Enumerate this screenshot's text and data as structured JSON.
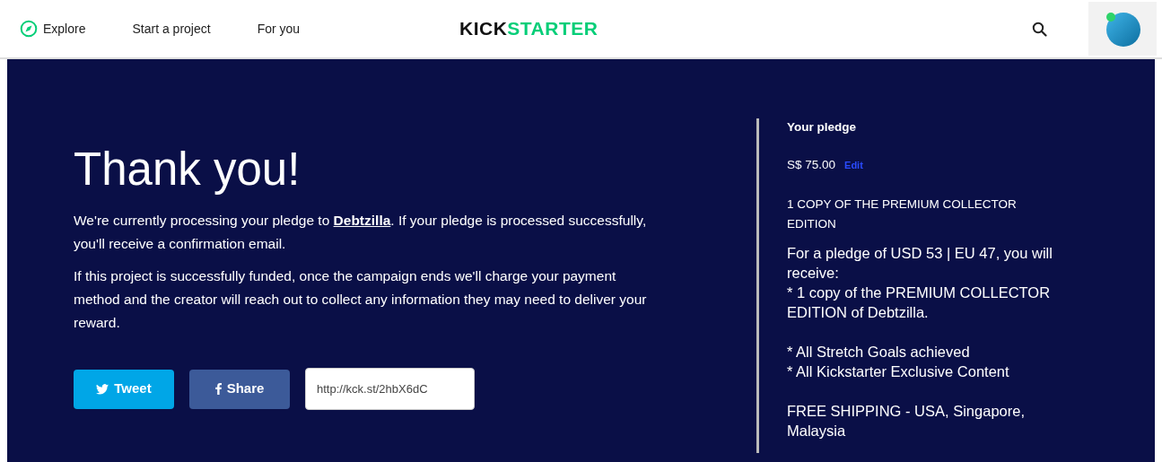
{
  "nav": {
    "items": [
      {
        "label": "Explore",
        "kind": "explore"
      },
      {
        "label": "Start a project",
        "kind": "plain"
      },
      {
        "label": "For you",
        "kind": "plain"
      }
    ],
    "logo": {
      "part_1": "KICK",
      "part_2": "STARTER"
    }
  },
  "thanks": {
    "title": "Thank you!",
    "paragraph_1": {
      "before": "We're currently processing your pledge to ",
      "link": "Debtzilla",
      "after": ". If your pledge is processed successfully, you'll receive a confirmation email."
    },
    "paragraph_2": "If this project is successfully funded, once the campaign ends we'll charge your payment method and the creator will reach out to collect any information they may need to deliver your reward.",
    "buttons": [
      {
        "label": "Tweet",
        "kind": "twitter"
      },
      {
        "label": "Share",
        "kind": "facebook"
      }
    ],
    "short_link": "http://kck.st/2hbX6dC"
  },
  "pledge": {
    "heading": "Your pledge",
    "amount": "S$ 75.00",
    "edit": "Edit",
    "reward_title": "1 COPY OF THE PREMIUM COLLECTOR EDITION",
    "description": "For a pledge of USD 53 | EU 47, you will receive:\n* 1 copy of the PREMIUM COLLECTOR EDITION of Debtzilla.\n\n* All Stretch Goals achieved\n* All Kickstarter Exclusive Content\n\nFREE SHIPPING - USA, Singapore, Malaysia"
  }
}
